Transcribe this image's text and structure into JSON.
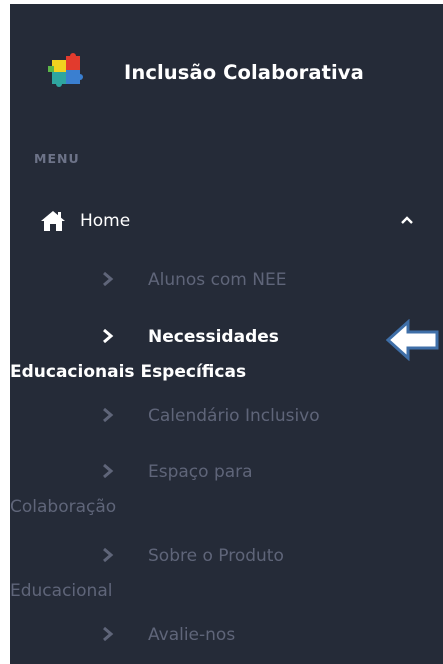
{
  "brand": {
    "title": "Inclusão Colaborativa",
    "logo_icon": "puzzle-pieces-icon"
  },
  "menu_heading": "MENU",
  "home": {
    "label": "Home",
    "icon": "home-icon",
    "expanded": true
  },
  "submenu": {
    "items": [
      {
        "line1": "Alunos com NEE",
        "line2": "",
        "active": false
      },
      {
        "line1": "Necessidades",
        "line2": "Educacionais Específicas",
        "active": true
      },
      {
        "line1": "Calendário Inclusivo",
        "line2": "",
        "active": false
      },
      {
        "line1": "Espaço para",
        "line2": "Colaboração",
        "active": false
      },
      {
        "line1": "Sobre o Produto",
        "line2": "Educacional",
        "active": false
      },
      {
        "line1": "Avalie-nos",
        "line2": "",
        "active": false
      }
    ]
  },
  "colors": {
    "sidebar_bg": "#252b38",
    "active_text": "#ffffff",
    "inactive_text": "#5f6579",
    "callout_arrow": "#3f6fa8"
  }
}
